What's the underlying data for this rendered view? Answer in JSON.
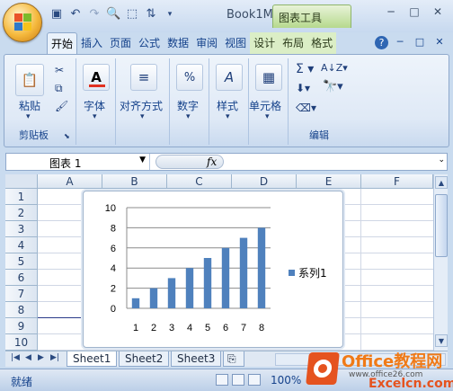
{
  "window": {
    "title": "Book1M",
    "context_tab": "图表工具",
    "controls": [
      "─",
      "□",
      "✕"
    ]
  },
  "quick_access": [
    "save-icon",
    "undo-icon",
    "redo-icon",
    "print-preview-icon",
    "format-painter-icon",
    "sort-icon"
  ],
  "ribbon": {
    "tabs": [
      {
        "label": "开始",
        "active": true
      },
      {
        "label": "插入"
      },
      {
        "label": "页面"
      },
      {
        "label": "公式"
      },
      {
        "label": "数据"
      },
      {
        "label": "审阅"
      },
      {
        "label": "视图"
      },
      {
        "label": "设计",
        "context": true
      },
      {
        "label": "布局",
        "context": true
      },
      {
        "label": "格式",
        "context": true
      }
    ],
    "right_controls": [
      "?",
      "─",
      "□",
      "✕"
    ],
    "groups": {
      "clipboard": {
        "paste": "粘贴",
        "label": "剪贴板"
      },
      "font": {
        "label": "字体"
      },
      "alignment": {
        "label": "对齐方式"
      },
      "number": {
        "label": "数字",
        "symbol": "%"
      },
      "styles": {
        "label": "样式"
      },
      "cells": {
        "label": "单元格"
      },
      "editing": {
        "label": "编辑"
      }
    }
  },
  "formula_bar": {
    "name_box": "图表 1",
    "fx": "fx"
  },
  "grid": {
    "columns": [
      "A",
      "B",
      "C",
      "D",
      "E",
      "F"
    ],
    "rows": [
      "1",
      "2",
      "3",
      "4",
      "5",
      "6",
      "7",
      "8",
      "9",
      "10"
    ]
  },
  "chart_data": {
    "type": "bar",
    "categories": [
      "1",
      "2",
      "3",
      "4",
      "5",
      "6",
      "7",
      "8"
    ],
    "series": [
      {
        "name": "系列1",
        "values": [
          1,
          2,
          3,
          4,
          5,
          6,
          7,
          8
        ],
        "color": "#4f81bd"
      }
    ],
    "ylim": [
      0,
      10
    ],
    "yticks": [
      "0",
      "2",
      "4",
      "6",
      "8",
      "10"
    ],
    "grid": true,
    "legend": "right"
  },
  "sheets": [
    {
      "label": "Sheet1",
      "active": true
    },
    {
      "label": "Sheet2"
    },
    {
      "label": "Sheet3"
    }
  ],
  "status": {
    "ready": "就绪",
    "zoom": "100%"
  },
  "watermark": {
    "brand": "Office教程网",
    "url": "www.office26.com",
    "site": "Excelcn.com"
  }
}
